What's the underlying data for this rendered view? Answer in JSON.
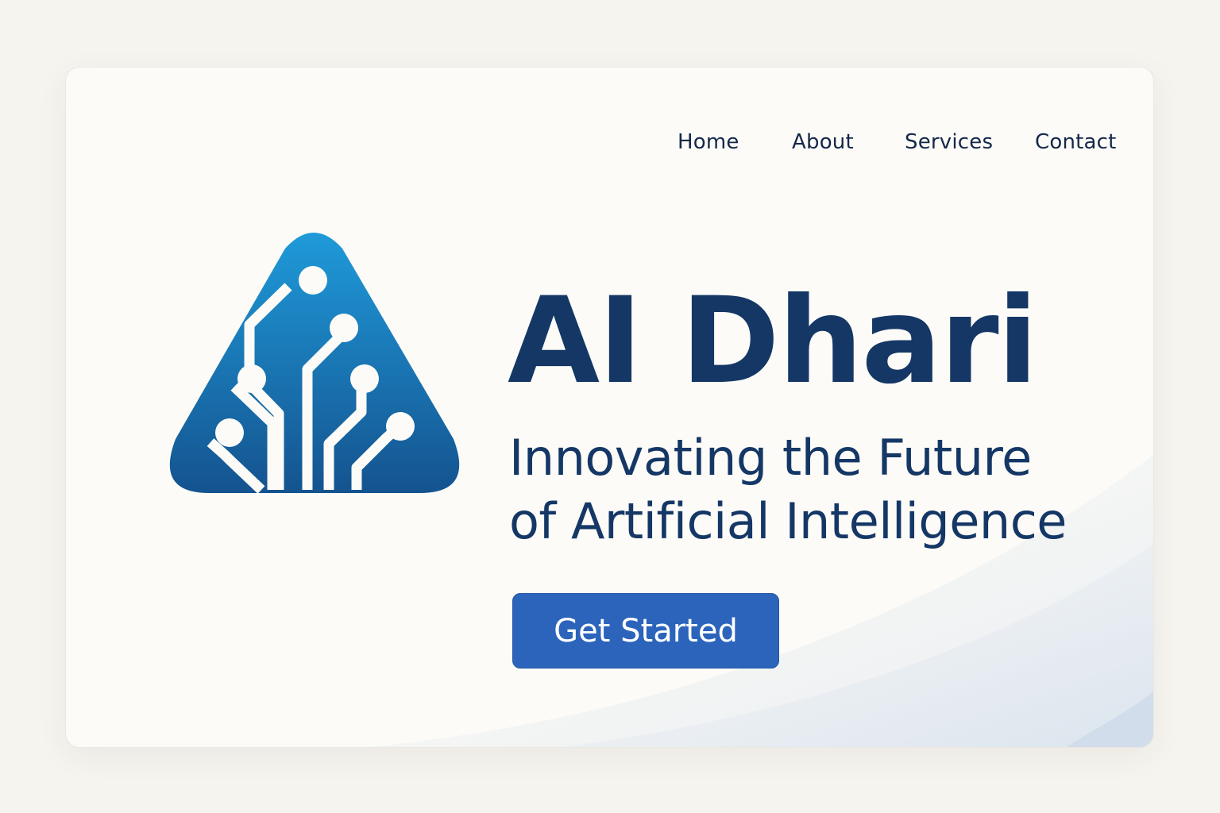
{
  "nav": {
    "items": [
      {
        "label": "Home"
      },
      {
        "label": "About"
      },
      {
        "label": "Services"
      },
      {
        "label": "Contact"
      }
    ]
  },
  "hero": {
    "brand": "AI Dhari",
    "tagline_line1": "Innovating the Future",
    "tagline_line2": "of Artificial Intelligence",
    "cta_label": "Get Started"
  },
  "logo": {
    "icon": "circuit-tree-triangle-icon",
    "gradient_top": "#1f9ad9",
    "gradient_bottom": "#14538f"
  },
  "colors": {
    "background": "#f6f4ef",
    "card": "#fcfbf7",
    "text_primary": "#143766",
    "cta": "#2c64bb"
  }
}
